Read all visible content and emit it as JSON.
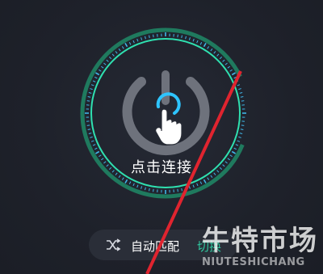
{
  "colors": {
    "background": "#1e212a",
    "ring_green": "#1f9e7a",
    "ring_teal": "#2fe0b0",
    "tick_blue": "#3fb6e8",
    "power_gray": "#6e727c",
    "power_accent": "#2ec4ff",
    "switch_green": "#2fc9a0",
    "annotation_red": "#e0242f",
    "pill_bg": "#2a2e38"
  },
  "connect": {
    "label": "点击连接",
    "icon": "power-icon",
    "cursor_icon": "hand-pointer-icon"
  },
  "mode": {
    "icon": "shuffle-icon",
    "label": "自动匹配",
    "switch_label": "切换"
  },
  "watermark": {
    "text_cn": "牛特市场",
    "text_en": "NIUTESHICHANG"
  }
}
